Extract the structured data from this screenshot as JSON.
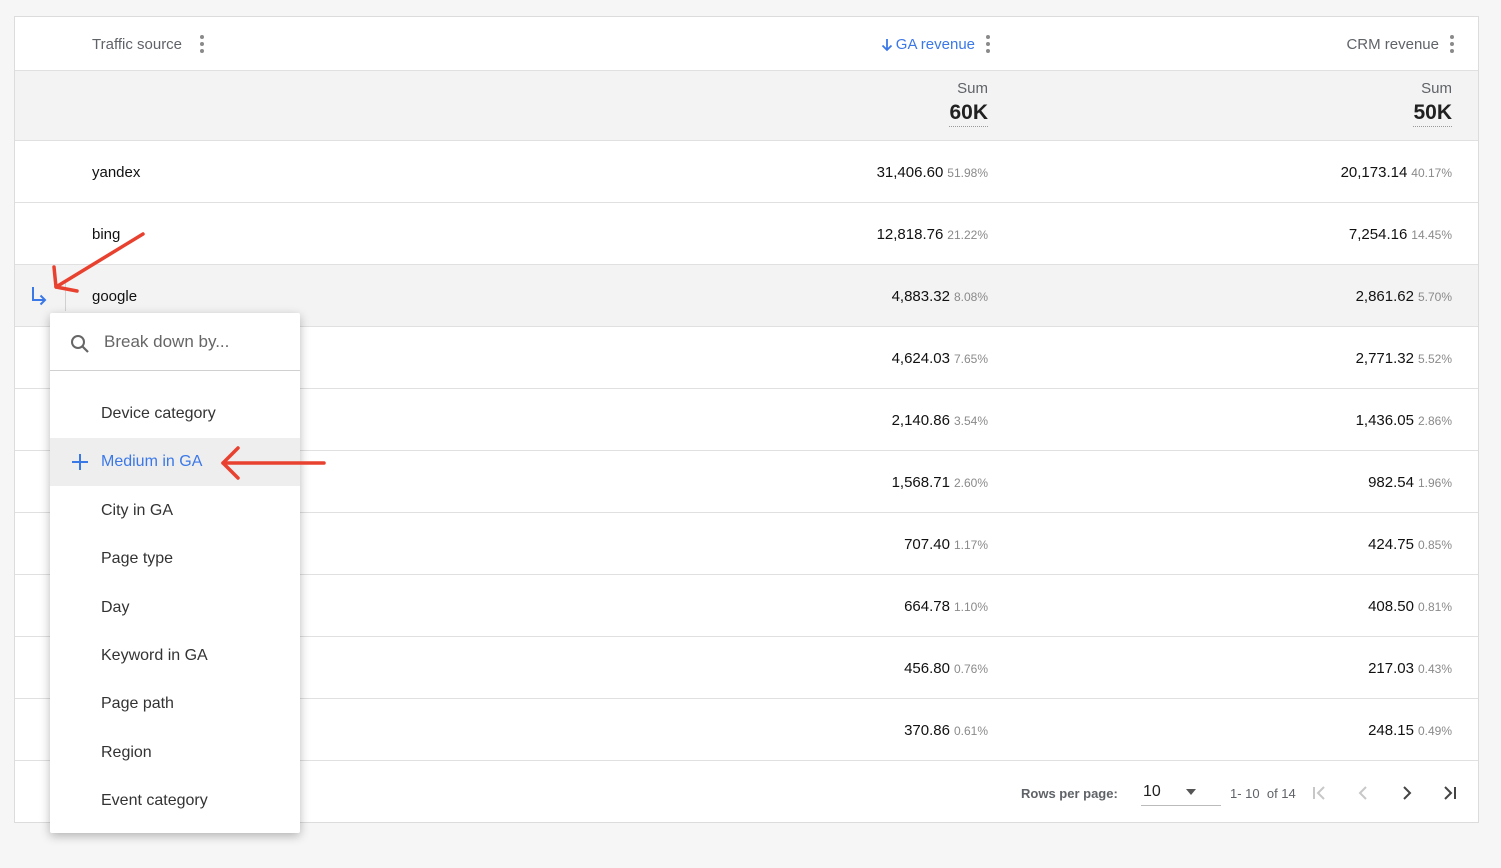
{
  "columns": {
    "source": "Traffic source",
    "ga_revenue": "GA revenue",
    "crm_revenue": "CRM revenue"
  },
  "summary": {
    "ga_caption": "Sum",
    "ga_total": "60K",
    "crm_caption": "Sum",
    "crm_total": "50K"
  },
  "rows": [
    {
      "name": "yandex",
      "ga": "31,406.60",
      "ga_pct": "51.98%",
      "crm": "20,173.14",
      "crm_pct": "40.17%"
    },
    {
      "name": "bing",
      "ga": "12,818.76",
      "ga_pct": "21.22%",
      "crm": "7,254.16",
      "crm_pct": "14.45%"
    },
    {
      "name": "google",
      "ga": "4,883.32",
      "ga_pct": "8.08%",
      "crm": "2,861.62",
      "crm_pct": "5.70%"
    },
    {
      "name": "",
      "ga": "4,624.03",
      "ga_pct": "7.65%",
      "crm": "2,771.32",
      "crm_pct": "5.52%"
    },
    {
      "name": "",
      "ga": "2,140.86",
      "ga_pct": "3.54%",
      "crm": "1,436.05",
      "crm_pct": "2.86%"
    },
    {
      "name": "",
      "ga": "1,568.71",
      "ga_pct": "2.60%",
      "crm": "982.54",
      "crm_pct": "1.96%"
    },
    {
      "name": "",
      "ga": "707.40",
      "ga_pct": "1.17%",
      "crm": "424.75",
      "crm_pct": "0.85%"
    },
    {
      "name": "",
      "ga": "664.78",
      "ga_pct": "1.10%",
      "crm": "408.50",
      "crm_pct": "0.81%"
    },
    {
      "name": "",
      "ga": "456.80",
      "ga_pct": "0.76%",
      "crm": "217.03",
      "crm_pct": "0.43%"
    },
    {
      "name": "",
      "ga": "370.86",
      "ga_pct": "0.61%",
      "crm": "248.15",
      "crm_pct": "0.49%"
    }
  ],
  "pagination": {
    "rows_per_page_label": "Rows per page:",
    "rows_per_page": "10",
    "range": "1- 10  of 14"
  },
  "breakdown_menu": {
    "search_placeholder": "Break down by...",
    "items": [
      {
        "label": "Device category"
      },
      {
        "label": "Medium in GA"
      },
      {
        "label": "City in GA"
      },
      {
        "label": "Page type"
      },
      {
        "label": "Day"
      },
      {
        "label": "Keyword in GA"
      },
      {
        "label": "Page path"
      },
      {
        "label": "Region"
      },
      {
        "label": "Event category"
      }
    ]
  },
  "colors": {
    "accent": "#3b78e7",
    "annotation": "#e8412f",
    "highlight_row": "#f3f3f3"
  },
  "icons": [
    "kebab-menu-icon",
    "sort-down-arrow-icon",
    "breakdown-arrow-icon",
    "search-icon",
    "plus-icon",
    "dropdown-caret-icon",
    "first-page-icon",
    "previous-page-icon",
    "next-page-icon",
    "last-page-icon"
  ]
}
